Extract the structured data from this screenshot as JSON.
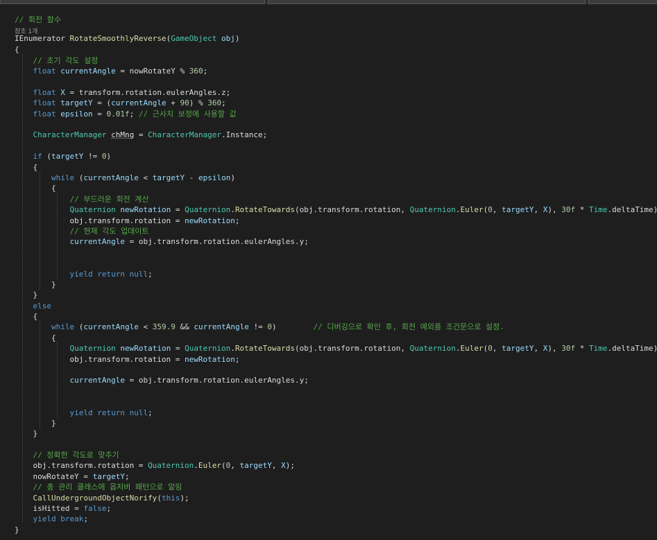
{
  "colors": {
    "background": "#1e1e1e",
    "comment": "#57a64a",
    "keyword": "#569cd6",
    "type": "#4ec9b0",
    "function": "#dcdcaa",
    "variable": "#9cdcfe",
    "number": "#b5cea8",
    "plain": "#dcdcdc"
  },
  "code_lines": [
    [
      [
        "// 회전 함수",
        "cm"
      ]
    ],
    [
      [
        "참조 1개",
        "ref"
      ]
    ],
    [
      [
        "IEnumerator ",
        "pl"
      ],
      [
        "RotateSmoothlyReverse",
        "fn"
      ],
      [
        "(",
        "pl"
      ],
      [
        "GameObject ",
        "ty"
      ],
      [
        "obj",
        "var"
      ],
      [
        ")",
        "pl"
      ]
    ],
    [
      [
        "{",
        "pl"
      ]
    ],
    [
      [
        "    // 초기 각도 설정",
        "cm"
      ]
    ],
    [
      [
        "    ",
        "pl"
      ],
      [
        "float ",
        "kw"
      ],
      [
        "currentAngle",
        "var"
      ],
      [
        " = nowRotateY % ",
        "pl"
      ],
      [
        "360",
        "num"
      ],
      [
        ";",
        "pl"
      ]
    ],
    [],
    [
      [
        "    ",
        "pl"
      ],
      [
        "float ",
        "kw"
      ],
      [
        "X",
        "var"
      ],
      [
        " = transform.rotation.eulerAngles.z;",
        "pl"
      ]
    ],
    [
      [
        "    ",
        "pl"
      ],
      [
        "float ",
        "kw"
      ],
      [
        "targetY",
        "var"
      ],
      [
        " = (",
        "pl"
      ],
      [
        "currentAngle",
        "var"
      ],
      [
        " + ",
        "pl"
      ],
      [
        "90",
        "num"
      ],
      [
        ") % ",
        "pl"
      ],
      [
        "360",
        "num"
      ],
      [
        ";",
        "pl"
      ]
    ],
    [
      [
        "    ",
        "pl"
      ],
      [
        "float ",
        "kw"
      ],
      [
        "epsilon",
        "var"
      ],
      [
        " = ",
        "pl"
      ],
      [
        "0.01f",
        "num"
      ],
      [
        "; ",
        "pl"
      ],
      [
        "// 근사치 보정에 사용할 값",
        "cm"
      ]
    ],
    [],
    [
      [
        "    ",
        "pl"
      ],
      [
        "CharacterManager ",
        "ty"
      ],
      [
        "chMng",
        "sq"
      ],
      [
        " = ",
        "pl"
      ],
      [
        "CharacterManager",
        "ty"
      ],
      [
        ".Instance;",
        "pl"
      ]
    ],
    [],
    [
      [
        "    ",
        "pl"
      ],
      [
        "if ",
        "kw"
      ],
      [
        "(",
        "pl"
      ],
      [
        "targetY",
        "var"
      ],
      [
        " != ",
        "pl"
      ],
      [
        "0",
        "num"
      ],
      [
        ")",
        "pl"
      ]
    ],
    [
      [
        "    {",
        "pl"
      ]
    ],
    [
      [
        "        ",
        "pl"
      ],
      [
        "while ",
        "kw"
      ],
      [
        "(",
        "pl"
      ],
      [
        "currentAngle",
        "var"
      ],
      [
        " < ",
        "pl"
      ],
      [
        "targetY",
        "var"
      ],
      [
        " - ",
        "pl"
      ],
      [
        "epsilon",
        "var"
      ],
      [
        ")",
        "pl"
      ]
    ],
    [
      [
        "        {",
        "pl"
      ]
    ],
    [
      [
        "            // 부드러운 회전 계산",
        "cm"
      ]
    ],
    [
      [
        "            ",
        "pl"
      ],
      [
        "Quaternion ",
        "ty"
      ],
      [
        "newRotation",
        "var"
      ],
      [
        " = ",
        "pl"
      ],
      [
        "Quaternion",
        "ty"
      ],
      [
        ".",
        "pl"
      ],
      [
        "RotateTowards",
        "fn"
      ],
      [
        "(obj.transform.rotation, ",
        "pl"
      ],
      [
        "Quaternion",
        "ty"
      ],
      [
        ".",
        "pl"
      ],
      [
        "Euler",
        "fn"
      ],
      [
        "(",
        "pl"
      ],
      [
        "0",
        "num"
      ],
      [
        ", ",
        "pl"
      ],
      [
        "targetY",
        "var"
      ],
      [
        ", ",
        "pl"
      ],
      [
        "X",
        "var"
      ],
      [
        "), ",
        "pl"
      ],
      [
        "30f",
        "num"
      ],
      [
        " * ",
        "pl"
      ],
      [
        "Time",
        "ty"
      ],
      [
        ".deltaTime);",
        "pl"
      ]
    ],
    [
      [
        "            obj.transform.rotation = ",
        "pl"
      ],
      [
        "newRotation",
        "var"
      ],
      [
        ";",
        "pl"
      ]
    ],
    [
      [
        "            // 현재 각도 업데이트",
        "cm"
      ]
    ],
    [
      [
        "            ",
        "pl"
      ],
      [
        "currentAngle",
        "var"
      ],
      [
        " = obj.transform.rotation.eulerAngles.y;",
        "pl"
      ]
    ],
    [],
    [],
    [
      [
        "            ",
        "pl"
      ],
      [
        "yield ",
        "kw"
      ],
      [
        "return ",
        "kw"
      ],
      [
        "null",
        "kw"
      ],
      [
        ";",
        "pl"
      ]
    ],
    [
      [
        "        }",
        "pl"
      ]
    ],
    [
      [
        "    }",
        "pl"
      ]
    ],
    [
      [
        "    ",
        "pl"
      ],
      [
        "else",
        "kw"
      ]
    ],
    [
      [
        "    {",
        "pl"
      ]
    ],
    [
      [
        "        ",
        "pl"
      ],
      [
        "while ",
        "kw"
      ],
      [
        "(",
        "pl"
      ],
      [
        "currentAngle",
        "var"
      ],
      [
        " < ",
        "pl"
      ],
      [
        "359.9",
        "num"
      ],
      [
        " && ",
        "pl"
      ],
      [
        "currentAngle",
        "var"
      ],
      [
        " != ",
        "pl"
      ],
      [
        "0",
        "num"
      ],
      [
        ")        ",
        "pl"
      ],
      [
        "// 디버깅으로 확인 후, 회전 예외를 조건문으로 설정.",
        "cm"
      ]
    ],
    [
      [
        "        {",
        "pl"
      ]
    ],
    [
      [
        "            ",
        "pl"
      ],
      [
        "Quaternion ",
        "ty"
      ],
      [
        "newRotation",
        "var"
      ],
      [
        " = ",
        "pl"
      ],
      [
        "Quaternion",
        "ty"
      ],
      [
        ".",
        "pl"
      ],
      [
        "RotateTowards",
        "fn"
      ],
      [
        "(obj.transform.rotation, ",
        "pl"
      ],
      [
        "Quaternion",
        "ty"
      ],
      [
        ".",
        "pl"
      ],
      [
        "Euler",
        "fn"
      ],
      [
        "(",
        "pl"
      ],
      [
        "0",
        "num"
      ],
      [
        ", ",
        "pl"
      ],
      [
        "targetY",
        "var"
      ],
      [
        ", ",
        "pl"
      ],
      [
        "X",
        "var"
      ],
      [
        "), ",
        "pl"
      ],
      [
        "30f",
        "num"
      ],
      [
        " * ",
        "pl"
      ],
      [
        "Time",
        "ty"
      ],
      [
        ".deltaTime);",
        "pl"
      ]
    ],
    [
      [
        "            obj.transform.rotation = ",
        "pl"
      ],
      [
        "newRotation",
        "var"
      ],
      [
        ";",
        "pl"
      ]
    ],
    [],
    [
      [
        "            ",
        "pl"
      ],
      [
        "currentAngle",
        "var"
      ],
      [
        " = obj.transform.rotation.eulerAngles.y;",
        "pl"
      ]
    ],
    [],
    [],
    [
      [
        "            ",
        "pl"
      ],
      [
        "yield ",
        "kw"
      ],
      [
        "return ",
        "kw"
      ],
      [
        "null",
        "kw"
      ],
      [
        ";",
        "pl"
      ]
    ],
    [
      [
        "        }",
        "pl"
      ]
    ],
    [
      [
        "    }",
        "pl"
      ]
    ],
    [],
    [
      [
        "    // 정확한 각도로 맞추기",
        "cm"
      ]
    ],
    [
      [
        "    obj.transform.rotation = ",
        "pl"
      ],
      [
        "Quaternion",
        "ty"
      ],
      [
        ".",
        "pl"
      ],
      [
        "Euler",
        "fn"
      ],
      [
        "(",
        "pl"
      ],
      [
        "0",
        "num"
      ],
      [
        ", ",
        "pl"
      ],
      [
        "targetY",
        "var"
      ],
      [
        ", ",
        "pl"
      ],
      [
        "X",
        "var"
      ],
      [
        ");",
        "pl"
      ]
    ],
    [
      [
        "    nowRotateY = ",
        "pl"
      ],
      [
        "targetY",
        "var"
      ],
      [
        ";",
        "pl"
      ]
    ],
    [
      [
        "    // 총 관리 클래스에 옵저버 패턴으로 알림",
        "cm"
      ]
    ],
    [
      [
        "    ",
        "pl"
      ],
      [
        "CallUndergroundObjectNorify",
        "fn"
      ],
      [
        "(",
        "pl"
      ],
      [
        "this",
        "kw"
      ],
      [
        ");",
        "pl"
      ]
    ],
    [
      [
        "    isHitted = ",
        "pl"
      ],
      [
        "false",
        "kw"
      ],
      [
        ";",
        "pl"
      ]
    ],
    [
      [
        "    ",
        "pl"
      ],
      [
        "yield ",
        "kw"
      ],
      [
        "break",
        "kw"
      ],
      [
        ";",
        "pl"
      ]
    ],
    [
      [
        "}",
        "pl"
      ]
    ]
  ]
}
